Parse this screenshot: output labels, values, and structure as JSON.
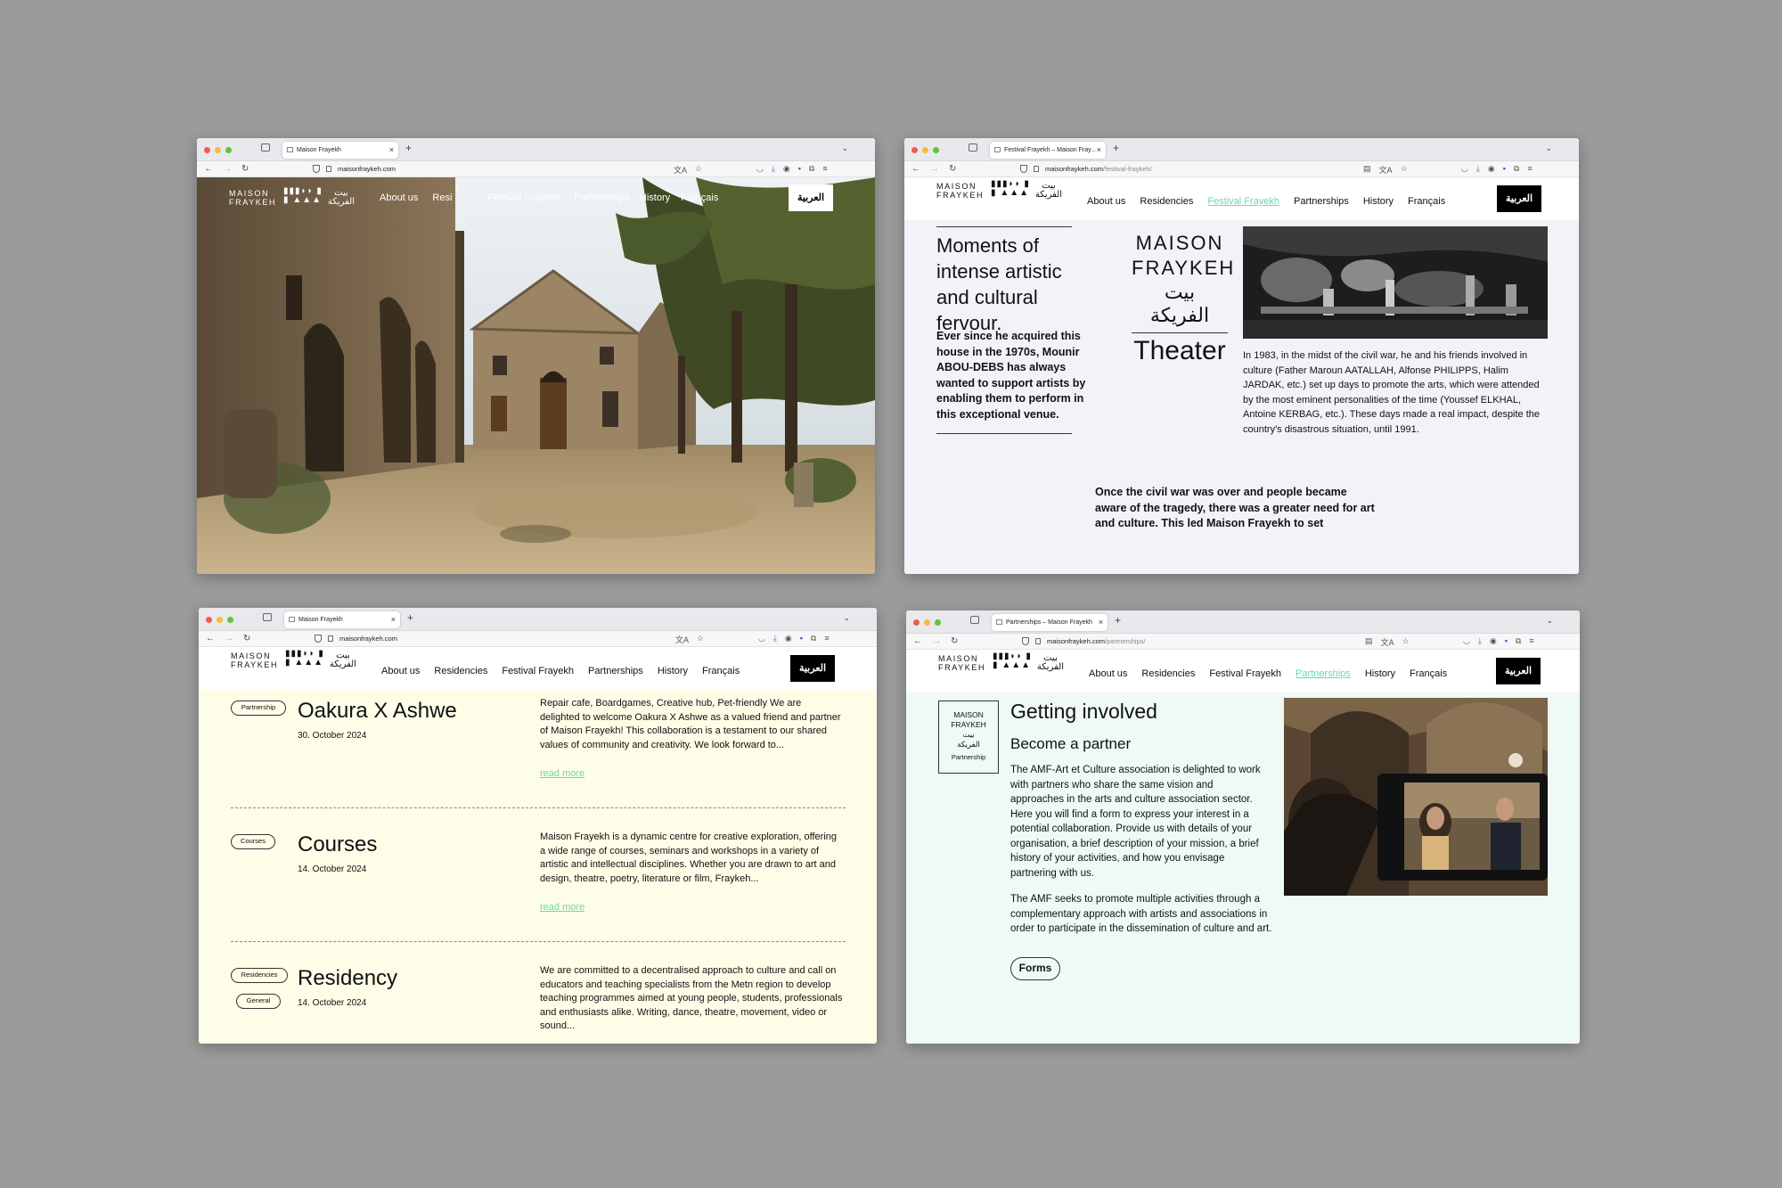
{
  "common": {
    "logo_line1": "MAISON",
    "logo_line2": "FRAYKEH",
    "logo_glyphs_1": "▮▮▮◗◗ ▮",
    "logo_glyphs_2": "▮ ▲▲▲",
    "logo_arabic_1": "بيت",
    "logo_arabic_2": "الفريكة",
    "menu": [
      "About us",
      "Residencies",
      "Festival Frayekh",
      "Partnerships",
      "History",
      "Français"
    ],
    "arabic_button": "العربية",
    "new_tab": "+",
    "tab_close": "×"
  },
  "window1": {
    "tab_title": "Maison Frayekh",
    "url_host": "maisonfraykeh.com",
    "url_path": "",
    "menu_visible": [
      "About us",
      "Resi",
      "Festival Frayekh",
      "Partnerships",
      "History",
      "Français"
    ]
  },
  "window2": {
    "tab_title": "Festival Frayekh – Maison Fray...",
    "url_host": "maisonfraykeh.com",
    "url_path": "/festival-fraykeh/",
    "active_menu": "Festival Frayekh",
    "heading": "Moments of intense artistic and cultural fervour.",
    "intro": "Ever since he acquired this house in the 1970s, Mounir ABOU-DEBS has always wanted to support artists by enabling them to perform in this exceptional venue.",
    "badge_latin_1": "MAISON",
    "badge_latin_2": "FRAYKEH",
    "badge_arabic_1": "بيت",
    "badge_arabic_2": "الفريكة",
    "badge_sub": "Theater",
    "history_text": "In 1983, in the midst of the civil war, he and his friends involved in culture (Father Maroun AATALLAH, Alfonse PHILIPPS, Halim JARDAK, etc.) set up days to promote the arts, which were attended by the most eminent personalities of the time (Youssef ELKHAL, Antoine KERBAG, etc.). These days made a real impact, despite the country's disastrous situation, until 1991.",
    "bottom_text": "Once the civil war was over and people became aware of the tragedy, there was a greater need for art and culture. This led Maison Frayekh to set"
  },
  "window3": {
    "tab_title": "Maison Frayekh",
    "url_host": "maisonfraykeh.com",
    "url_path": "",
    "read_more": "read more",
    "posts": [
      {
        "tags": [
          "Partnership"
        ],
        "title": "Oakura X Ashwe",
        "date": "30. October 2024",
        "excerpt": "Repair cafe, Boardgames, Creative hub, Pet-friendly We are delighted to welcome Oakura X Ashwe as a valued friend and partner of Maison Frayekh! This collaboration is a testament to our shared values of community and creativity. We look forward to..."
      },
      {
        "tags": [
          "Courses"
        ],
        "title": "Courses",
        "date": "14. October 2024",
        "excerpt": "Maison Frayekh is a dynamic centre for creative exploration, offering a wide range of courses, seminars and workshops in a variety of artistic and intellectual disciplines. Whether you are drawn to art and design, theatre, poetry, literature or film, Fraykeh..."
      },
      {
        "tags": [
          "Residencies",
          "General"
        ],
        "title": "Residency",
        "date": "14. October 2024",
        "excerpt": "We are committed to a decentralised approach to culture and call on educators and teaching specialists from the Metn region to develop teaching programmes aimed at young people, students, professionals and enthusiasts alike. Writing, dance, theatre, movement, video or sound..."
      }
    ]
  },
  "window4": {
    "tab_title": "Partnerships – Maison Frayekh",
    "url_host": "maisonfraykeh.com",
    "url_path": "/partnerships/",
    "active_menu": "Partnerships",
    "badge_latin_1": "MAISON",
    "badge_latin_2": "FRAYKEH",
    "badge_arabic_1": "بيت",
    "badge_arabic_2": "الفريكة",
    "badge_sub": "Partnership",
    "heading": "Getting involved",
    "subheading": "Become a partner",
    "para1": "The AMF-Art et Culture association is delighted to work with partners who share the same vision and approaches in the arts and culture association sector. Here you will find a form to express your interest in a potential collaboration. Provide us with details of your organisation, a brief description of your mission, a brief history of your activities, and how you envisage partnering with us.",
    "para2": "The AMF seeks to promote multiple activities through a complementary approach with artists and associations in order to participate in the dissemination of culture and art.",
    "forms_button": "Forms"
  },
  "colors": {
    "backdrop": "#9b9b9b",
    "accent_mint": "#6bd9a5",
    "page_lavender": "#f4f2f8",
    "page_cream": "#fdfde8",
    "page_mint": "#eefaf3",
    "arabic_button_bg": "#000000"
  }
}
